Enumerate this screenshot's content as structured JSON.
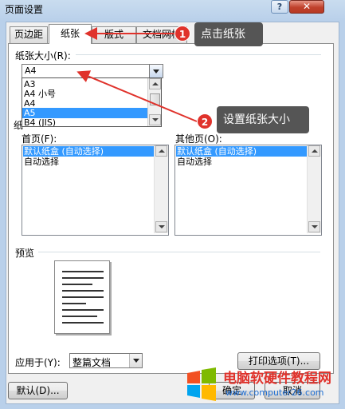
{
  "window": {
    "title": "页面设置",
    "help_label": "?",
    "close_label": "✕"
  },
  "tabs": [
    {
      "label": "页边距",
      "active": false
    },
    {
      "label": "纸张",
      "active": true
    },
    {
      "label": "版式",
      "active": false
    },
    {
      "label": "文档网格",
      "active": false
    }
  ],
  "paper_size": {
    "label": "纸张大小(R):",
    "value": "A4",
    "options": [
      {
        "label": "A3",
        "selected": false
      },
      {
        "label": "A4 小号",
        "selected": false
      },
      {
        "label": "A4",
        "selected": false
      },
      {
        "label": "A5",
        "selected": true
      },
      {
        "label": "B4 (JIS)",
        "selected": false
      }
    ]
  },
  "paper_source": {
    "label_partial": "纸",
    "first_page": {
      "label": "首页(F):",
      "items": [
        "默认纸盒 (自动选择)",
        "自动选择"
      ],
      "selected": 0
    },
    "other_pages": {
      "label": "其他页(O):",
      "items": [
        "默认纸盒 (自动选择)",
        "自动选择"
      ],
      "selected": 0
    }
  },
  "preview": {
    "label": "预览"
  },
  "apply_to": {
    "label": "应用于(Y):",
    "value": "整篇文档"
  },
  "buttons": {
    "print_options": "打印选项(T)...",
    "default": "默认(D)...",
    "ok": "确定",
    "cancel": "取消"
  },
  "annotations": [
    {
      "number": "1",
      "text": "点击纸张"
    },
    {
      "number": "2",
      "text": "设置纸张大小"
    }
  ],
  "watermark": {
    "name": "电脑软硬件教程网",
    "url": "www.computer26.com"
  },
  "colors": {
    "selection": "#3399ff",
    "callout_bg": "#555555",
    "badge": "#e0322b",
    "arrow": "#e0322b",
    "watermark_url": "#1f6fd4"
  }
}
